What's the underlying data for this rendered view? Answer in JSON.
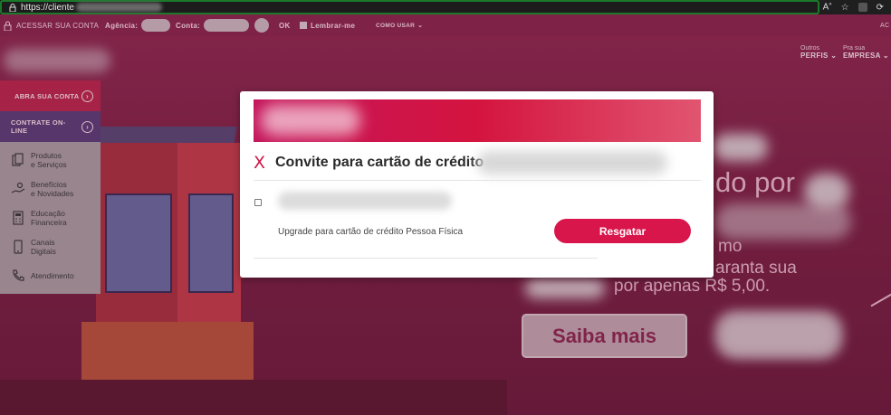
{
  "browser": {
    "url": "https://cliente"
  },
  "topnav": {
    "account_link": "ACESSAR SUA CONTA",
    "agency_label": "Agência:",
    "account_label": "Conta:",
    "ok_label": "OK",
    "remember_label": "Lembrar-me",
    "how_to_label": "COMO USAR",
    "right_cut": "AC"
  },
  "profiles": [
    {
      "small": "Outros",
      "label": "PERFIS"
    },
    {
      "small": "Pra sua",
      "label": "EMPRESA"
    }
  ],
  "sidebar": {
    "open_account": "ABRA SUA CONTA",
    "hire_online": "CONTRATE ON-LINE",
    "items": [
      {
        "line1": "Produtos",
        "line2": "e Serviços",
        "icon": "documents-icon"
      },
      {
        "line1": "Benefícios",
        "line2": "e Novidades",
        "icon": "hand-coin-icon"
      },
      {
        "line1": "Educação",
        "line2": "Financeira",
        "icon": "calculator-icon"
      },
      {
        "line1": "Canais",
        "line2": "Digitais",
        "icon": "mobile-icon"
      },
      {
        "line1": "Atendimento",
        "line2": "",
        "icon": "phone-icon"
      }
    ]
  },
  "hero": {
    "line1": "do por",
    "line2": "mo",
    "line3": "aranta sua",
    "line4": "por apenas R$ 5,00.",
    "cta": "Saiba mais"
  },
  "modal": {
    "title": "Convite para cartão de crédito",
    "close_symbol": "X",
    "description": "Upgrade para cartão de crédito Pessoa Física",
    "button": "Resgatar"
  },
  "colors": {
    "brand": "#d9164c",
    "nav_bg": "#8b2750",
    "url_border": "#1b7a2a"
  }
}
